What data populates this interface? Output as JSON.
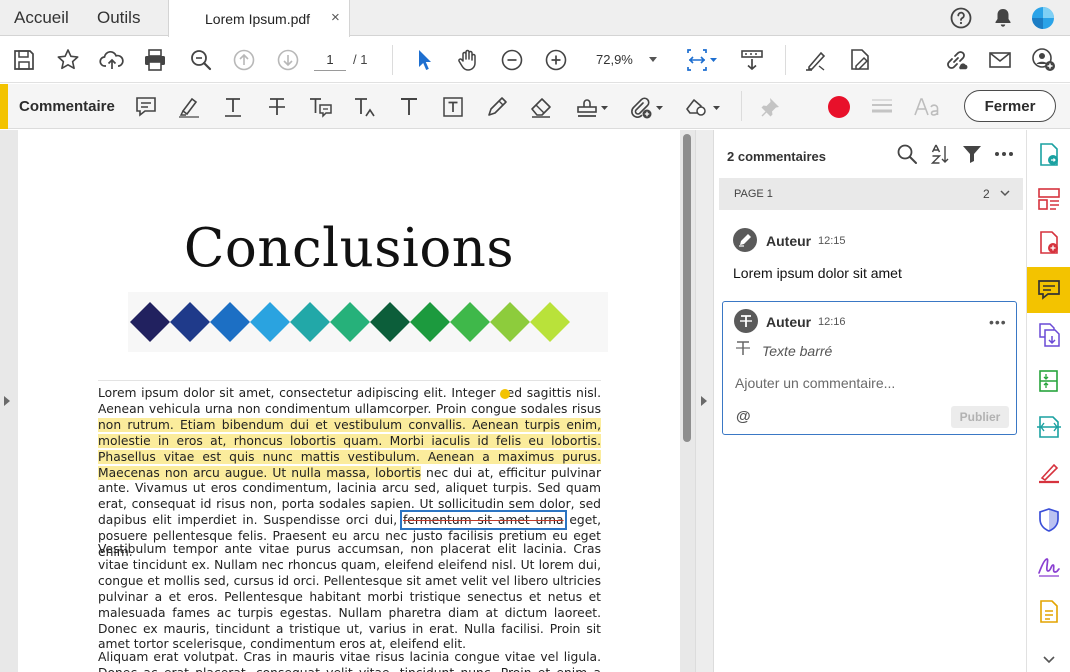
{
  "tabs": {
    "home": "Accueil",
    "tools": "Outils",
    "document": "Lorem Ipsum.pdf",
    "close_glyph": "×"
  },
  "toolbar": {
    "page_current": "1",
    "page_total": "/  1",
    "zoom": "72,9%"
  },
  "comment_toolbar": {
    "title": "Commentaire",
    "close_label": "Fermer",
    "annotation_color": "#e8102a",
    "accent_color": "#f3c300"
  },
  "document": {
    "title": "Conclusions",
    "diamond_colors": [
      "#21215f",
      "#1f3a8a",
      "#1c6fc4",
      "#2aa3e0",
      "#22a8a8",
      "#26b17a",
      "#0c5e3a",
      "#1c9a3e",
      "#3fb84a",
      "#8dcc3c",
      "#b9e23a"
    ],
    "p1_a": "Lorem ipsum dolor sit amet, consectetur adipiscing elit. Integer sed sagittis nisl. Aenean vehicula urna non condimentum ullamcorper. Proin congue sodales risus ",
    "p1_hl": "non rutrum. Etiam bibendum dui et vestibulum convallis. Aenean turpis enim, molestie in eros at, rhoncus lobortis quam. Morbi iaculis id felis eu lobortis. Phasellus vitae est quis nunc mattis vestibulum. Aenean a maximus purus. Maecenas non arcu augue. Ut nulla massa, lobortis",
    "p1_b": " nec dui at, efficitur pulvinar ante. Vivamus ut eros condimentum, lacinia arcu sed, aliquet turpis. Sed quam erat, consequat id risus non, porta sodales sapien. Ut sollicitudin sem dolor, sed dapibus elit imperdiet in. Suspendisse orci dui, ",
    "p1_strike": "fermentum sit amet urna",
    "p1_c": " eget, posuere pellentesque felis. Praesent eu arcu nec justo facilisis pretium eu eget enim.",
    "p2": "Vestibulum tempor ante vitae purus accumsan, non placerat elit lacinia. Cras vitae tincidunt ex. Nullam nec rhoncus quam, eleifend eleifend nisl. Ut lorem dui, congue et mollis sed, cursus id orci. Pellentesque sit amet velit vel libero ultricies pulvinar a et eros. Pellentesque habitant morbi tristique senectus et netus et malesuada fames ac turpis egestas. Nullam pharetra diam at dictum laoreet. Donec ex mauris, tincidunt a tristique ut, varius in erat. Nulla facilisi. Proin sit amet tortor scelerisque, condimentum eros at, eleifend elit.",
    "p3": "Aliquam erat volutpat. Cras in mauris vitae risus lacinia congue vitae vel ligula. Donec ac erat placerat, consequat velit vitae, tincidunt nunc. Proin et enim a nunc eleifend tempor."
  },
  "comments": {
    "header": "2 commentaires",
    "page_label": "PAGE 1",
    "page_count": "2",
    "items": [
      {
        "author": "Auteur",
        "time": "12:15",
        "text": "Lorem ipsum dolor sit amet"
      },
      {
        "author": "Auteur",
        "time": "12:16",
        "type": "Texte barré",
        "menu": "•••"
      }
    ],
    "reply_placeholder": "Ajouter un commentaire...",
    "mention": "@",
    "publish_label": "Publier"
  }
}
